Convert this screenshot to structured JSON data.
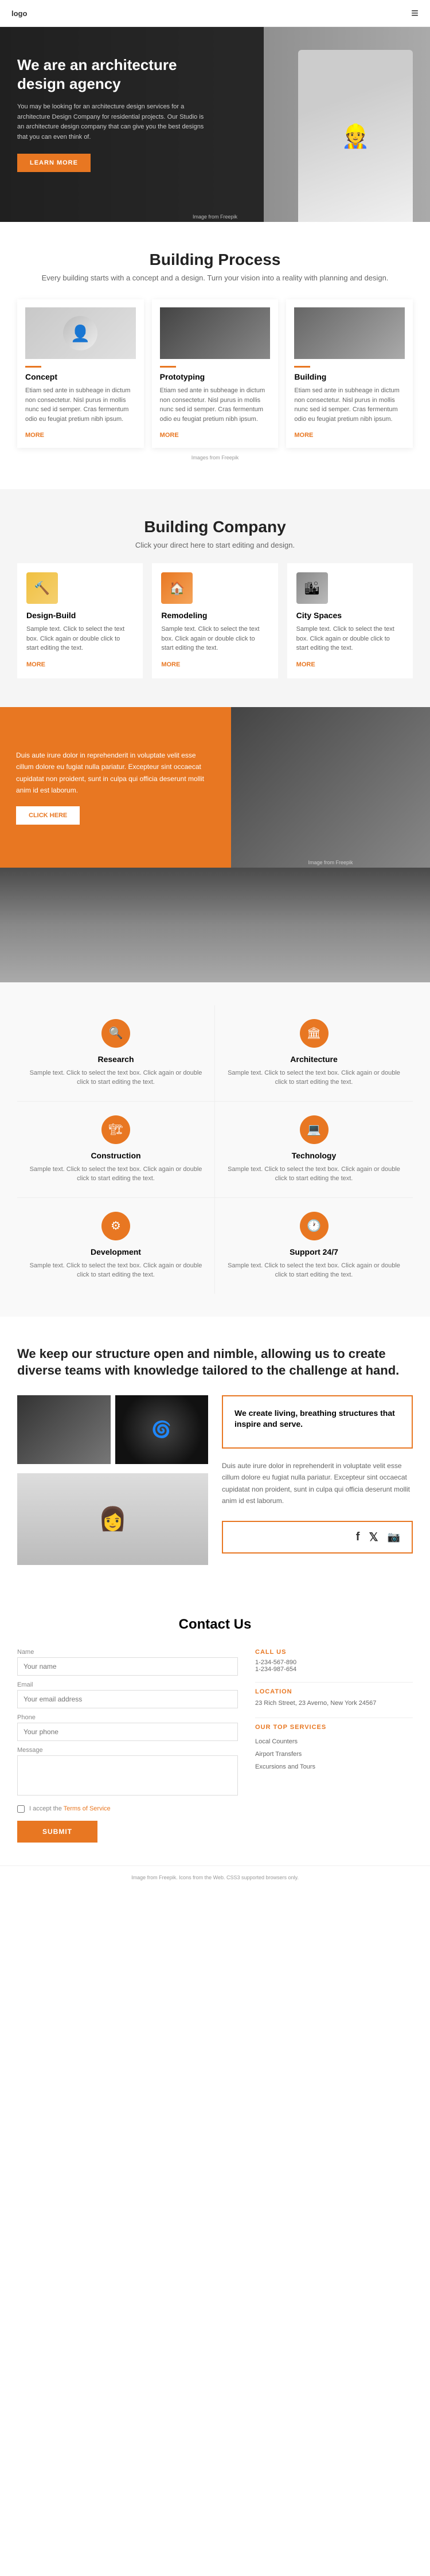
{
  "header": {
    "logo": "logo",
    "hamburger": "≡"
  },
  "hero": {
    "title": "We are an architecture design agency",
    "description": "You may be looking for an architecture design services for a architecture Design Company for residential projects. Our Studio is an architecture design company that can give you the best designs that you can even think of.",
    "button_label": "LEARN MORE",
    "image_credit": "Image from Freepik"
  },
  "building_process": {
    "title": "Building Process",
    "subtitle": "Every building starts with a concept and a design. Turn your vision into a reality with planning and design.",
    "cards": [
      {
        "title": "Concept",
        "text": "Etiam sed ante in subheage in dictum non consectetur. Nisl purus in mollis nunc sed id semper. Cras fermentum odio eu feugiat pretium nibh ipsum.",
        "more": "MORE"
      },
      {
        "title": "Prototyping",
        "text": "Etiam sed ante in subheage in dictum non consectetur. Nisl purus in mollis nunc sed id semper. Cras fermentum odio eu feugiat pretium nibh ipsum.",
        "more": "MORE"
      },
      {
        "title": "Building",
        "text": "Etiam sed ante in subheage in dictum non consectetur. Nisl purus in mollis nunc sed id semper. Cras fermentum odio eu feugiat pretium nibh ipsum.",
        "more": "MORE"
      }
    ],
    "image_credit": "Images from Freepik"
  },
  "building_company": {
    "title": "Building Company",
    "subtitle": "Click your direct here to start editing and design.",
    "cards": [
      {
        "title": "Design-Build",
        "text": "Sample text. Click to select the text box. Click again or double click to start editing the text.",
        "more": "MORE"
      },
      {
        "title": "Remodeling",
        "text": "Sample text. Click to select the text box. Click again or double click to start editing the text.",
        "more": "MORE"
      },
      {
        "title": "City Spaces",
        "text": "Sample text. Click to select the text box. Click again or double click to start editing the text.",
        "more": "MORE"
      }
    ]
  },
  "orange_section": {
    "text": "Duis aute irure dolor in reprehenderit in voluptate velit esse cillum dolore eu fugiat nulla pariatur. Excepteur sint occaecat cupidatat non proident, sunt in culpa qui officia deserunt mollit anim id est laborum.",
    "button_label": "CLICK HERE",
    "image_credit": "Image from Freepik"
  },
  "features": {
    "items": [
      {
        "icon": "🔍",
        "title": "Research",
        "text": "Sample text. Click to select the text box. Click again or double click to start editing the text."
      },
      {
        "icon": "🏛",
        "title": "Architecture",
        "text": "Sample text. Click to select the text box. Click again or double click to start editing the text."
      },
      {
        "icon": "🏗",
        "title": "Construction",
        "text": "Sample text. Click to select the text box. Click again or double click to start editing the text."
      },
      {
        "icon": "💻",
        "title": "Technology",
        "text": "Sample text. Click to select the text box. Click again or double click to start editing the text."
      },
      {
        "icon": "⚙",
        "title": "Development",
        "text": "Sample text. Click to select the text box. Click again or double click to start editing the text."
      },
      {
        "icon": "🕐",
        "title": "Support 24/7",
        "text": "Sample text. Click to select the text box. Click again or double click to start editing the text."
      }
    ]
  },
  "structure": {
    "title": "We keep our structure open and nimble, allowing us to create diverse teams with knowledge tailored to the challenge at hand.",
    "box": {
      "title": "We create living, breathing structures that inspire and serve.",
      "text": ""
    },
    "right_text": "Duis aute irure dolor in reprehenderit in voluptate velit esse cillum dolore eu fugiat nulla pariatur. Excepteur sint occaecat cupidatat non proident, sunt in culpa qui officia deserunt mollit anim id est laborum."
  },
  "social": {
    "icons": [
      "f",
      "𝕏",
      "📷"
    ]
  },
  "contact": {
    "title": "Contact Us",
    "form": {
      "name_label": "Name",
      "name_placeholder": "Your name",
      "email_label": "Email",
      "email_placeholder": "Your email address",
      "phone_label": "Phone",
      "phone_placeholder": "Your phone",
      "message_label": "Message",
      "message_placeholder": "",
      "checkbox_text": "I accept the Terms of Service",
      "submit_label": "SUBMIT"
    },
    "info": {
      "call_us_label": "CALL US",
      "phone1": "1-234-567-890",
      "phone2": "1-234-987-654",
      "location_label": "LOCATION",
      "address": "23 Rich Street, 23 Averno, New York 24567",
      "services_label": "OUR TOP SERVICES",
      "services": [
        "Local Counters",
        "Airport Transfers",
        "Excursions and Tours"
      ]
    }
  },
  "footer": {
    "credit": "Image from Freepik. Icons from the Web. CSS3 supported browsers only."
  },
  "colors": {
    "orange": "#e87722",
    "dark": "#222222",
    "light_gray": "#f5f5f5",
    "text_gray": "#666666"
  }
}
